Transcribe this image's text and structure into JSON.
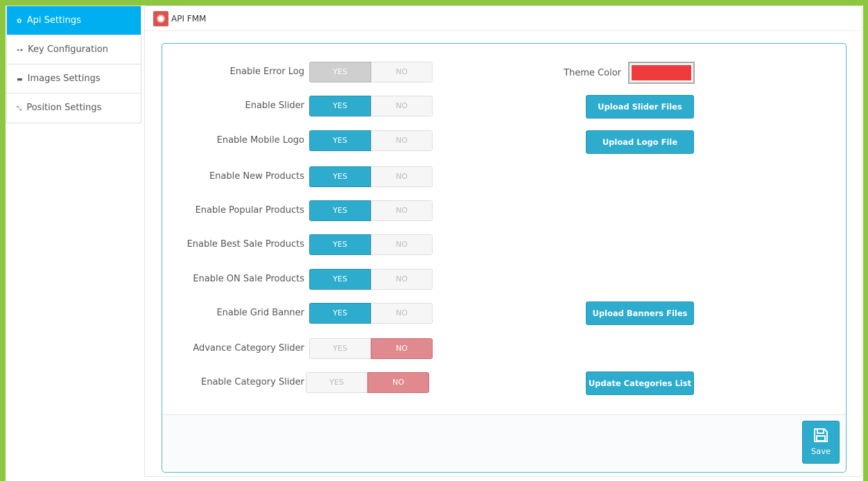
{
  "sidebar": {
    "items": [
      {
        "label": "Api Settings",
        "icon": "gear-icon",
        "glyph": "✿"
      },
      {
        "label": "Key Configuration",
        "icon": "key-icon",
        "glyph": "⊶"
      },
      {
        "label": "Images Settings",
        "icon": "images-icon",
        "glyph": "▬"
      },
      {
        "label": "Position Settings",
        "icon": "arrows-icon",
        "glyph": "⤡"
      }
    ]
  },
  "header": {
    "title": "API FMM"
  },
  "form": {
    "yes": "YES",
    "no": "NO",
    "rows": [
      {
        "label": "Enable Error Log",
        "value": "YES"
      },
      {
        "label": "Enable Slider",
        "value": "YES"
      },
      {
        "label": "Enable Mobile Logo",
        "value": "YES"
      },
      {
        "label": "Enable New Products",
        "value": "YES"
      },
      {
        "label": "Enable Popular Products",
        "value": "YES"
      },
      {
        "label": "Enable Best Sale Products",
        "value": "YES"
      },
      {
        "label": "Enable ON Sale Products",
        "value": "YES"
      },
      {
        "label": "Enable Grid Banner",
        "value": "YES"
      },
      {
        "label": "Advance Category Slider",
        "value": "NO"
      },
      {
        "label": "Enable Category Slider",
        "value": "NO"
      }
    ],
    "theme_color": {
      "label": "Theme Color",
      "value": "#ef3b3b"
    },
    "buttons": {
      "upload_slider": "Upload Slider Files",
      "upload_logo": "Upload Logo File",
      "upload_banners": "Upload Banners Files",
      "update_categories": "Update Categories List"
    },
    "save": "Save"
  },
  "colors": {
    "accent": "#2eacce",
    "active_nav": "#00aff0",
    "no_red": "#e08a8f",
    "frame": "#8dc63f"
  }
}
